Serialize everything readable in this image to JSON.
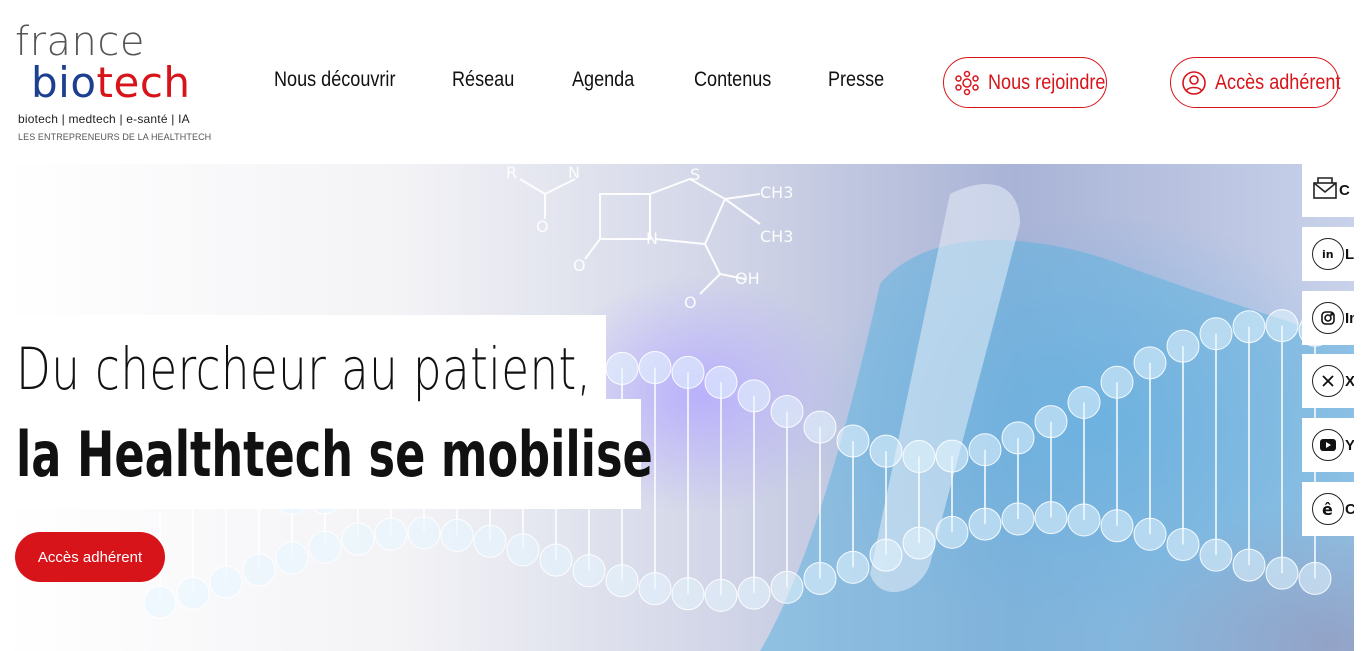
{
  "logo": {
    "word1": "france",
    "word2_blue": "bio",
    "word2_red": "tech",
    "tagline": "biotech | medtech | e-santé | IA",
    "subtagline": "LES ENTREPRENEURS DE LA HEALTHTECH"
  },
  "nav": {
    "items": [
      {
        "label": "Nous découvrir"
      },
      {
        "label": "Réseau"
      },
      {
        "label": "Agenda"
      },
      {
        "label": "Contenus"
      },
      {
        "label": "Presse"
      }
    ],
    "join_label": "Nous rejoindre",
    "member_label": "Accès adhérent"
  },
  "hero": {
    "line1": "Du chercheur au patient,",
    "line2": "la Healthtech se mobilise",
    "cta_label": "Accès adhérent",
    "chem_labels": {
      "r": "R",
      "n1": "N",
      "s": "S",
      "ch3a": "CH3",
      "ch3b": "CH3",
      "n2": "N",
      "o1": "O",
      "o2": "O",
      "o3": "O",
      "oh": "OH"
    }
  },
  "social": [
    {
      "icon": "envelope-icon",
      "label": "C"
    },
    {
      "icon": "linkedin-icon",
      "label": "Li"
    },
    {
      "icon": "instagram-icon",
      "label": "In"
    },
    {
      "icon": "x-icon",
      "label": "X"
    },
    {
      "icon": "youtube-icon",
      "label": "Y"
    },
    {
      "icon": "e-icon",
      "label": "C"
    }
  ],
  "colors": {
    "brand_red": "#d7141a",
    "brand_blue": "#1d3f8f"
  }
}
